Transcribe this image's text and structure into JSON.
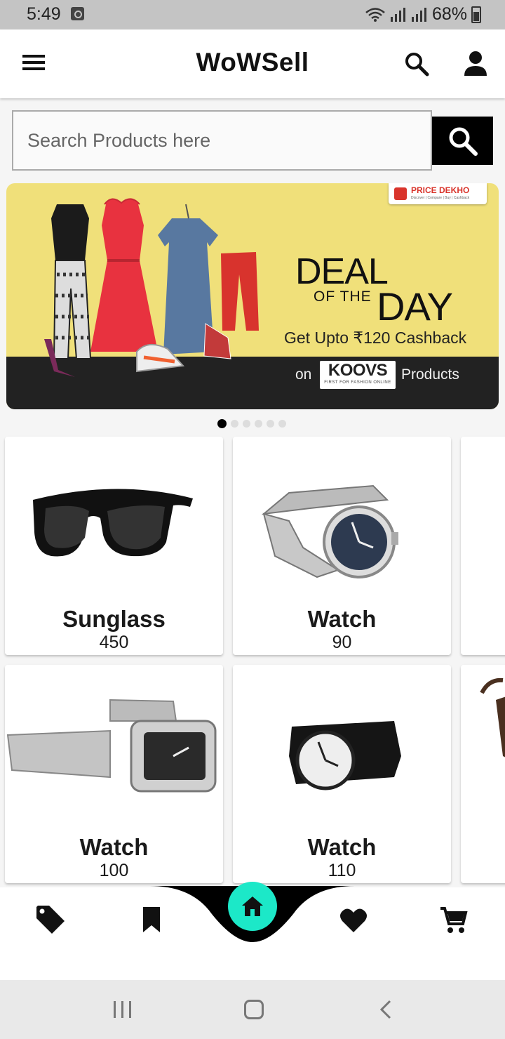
{
  "status_bar": {
    "time": "5:49",
    "battery": "68%"
  },
  "app_bar": {
    "title": "WoWSell"
  },
  "search": {
    "placeholder": "Search Products here"
  },
  "banner": {
    "badge": "PRICE DEKHO",
    "badge_sub": "Discover | Compare | Buy | Cashback",
    "headline_1": "DEAL",
    "headline_of_the": "OF THE",
    "headline_2": "DAY",
    "cashback": "Get Upto ₹120 Cashback",
    "on": "on",
    "brand": "KOOVS",
    "brand_tag": "FIRST FOR FASHION ONLINE",
    "products": "Products",
    "slides": 6,
    "active_slide": 1
  },
  "products": [
    {
      "name": "Sunglass",
      "price": "450",
      "icon": "sunglasses-image"
    },
    {
      "name": "Watch",
      "price": "90",
      "icon": "steel-watch-image"
    },
    {
      "name": "Watch",
      "price": "100",
      "icon": "rectangular-watch-image"
    },
    {
      "name": "Watch",
      "price": "110",
      "icon": "black-strap-watch-image"
    }
  ],
  "bottom_nav": {
    "items": [
      "tag-icon",
      "bookmark-icon",
      "home-icon",
      "heart-icon",
      "cart-icon"
    ],
    "accent": "#1ce8c8"
  },
  "colors": {
    "status_bar": "#c4c4c4",
    "banner_bg": "#f0e07a",
    "accent": "#1ce8c8"
  }
}
